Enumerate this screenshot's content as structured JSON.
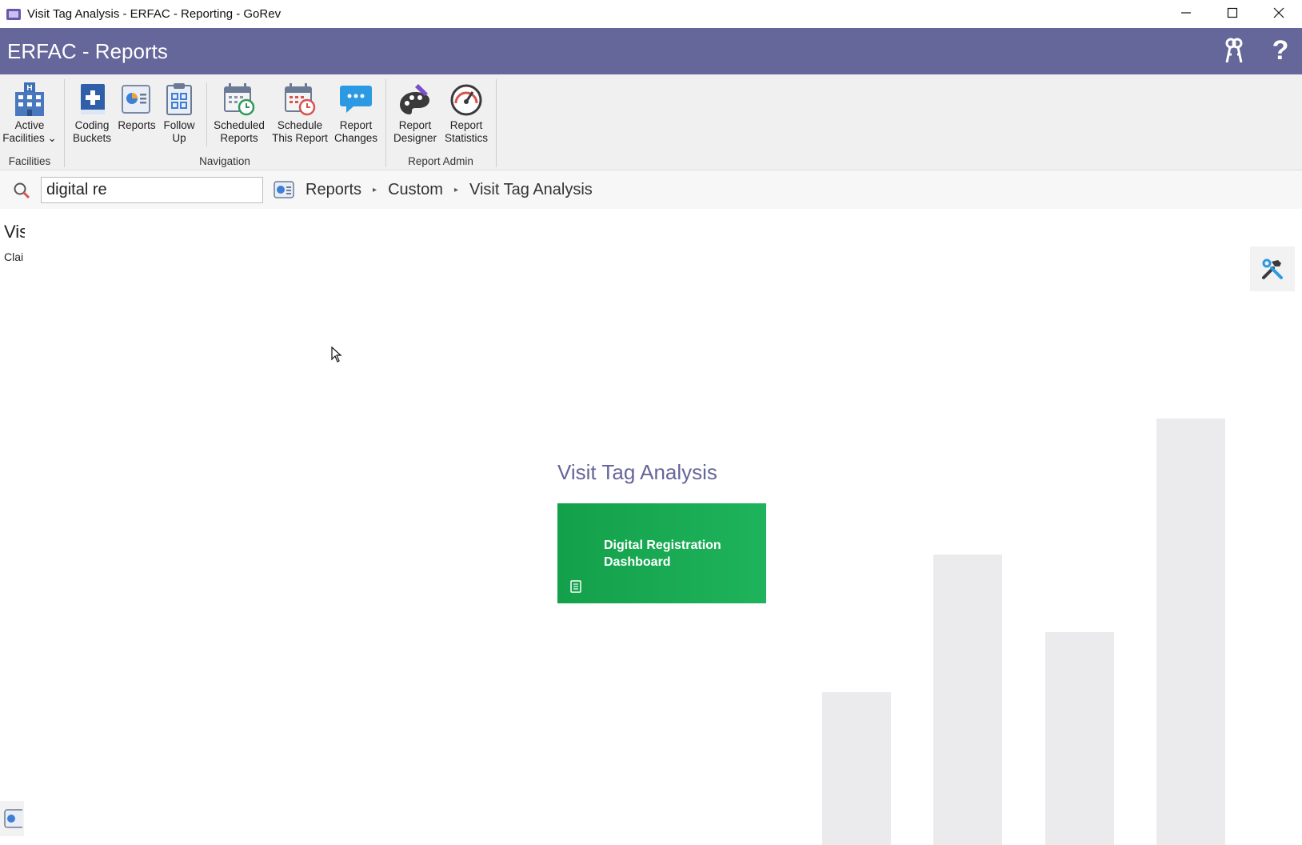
{
  "window": {
    "title": "Visit Tag Analysis - ERFAC - Reporting - GoRev",
    "controls": [
      "minimize-icon",
      "maximize-icon",
      "close-icon"
    ]
  },
  "header": {
    "title": "ERFAC - Reports",
    "icons": [
      "keys-icon",
      "help-icon"
    ],
    "help_glyph": "?"
  },
  "ribbon": {
    "groups": [
      {
        "label": "Facilities",
        "buttons": [
          {
            "label": "Active\nFacilities ⌄",
            "icon": "hospital-icon"
          }
        ]
      },
      {
        "label": "Navigation",
        "buttons": [
          {
            "label": "Coding\nBuckets",
            "icon": "coding-book-icon"
          },
          {
            "label": "Reports",
            "icon": "reports-icon"
          },
          {
            "label": "Follow\nUp",
            "icon": "clipboard-icon"
          },
          {
            "label": "Scheduled\nReports",
            "icon": "calendar-clock-icon"
          },
          {
            "label": "Schedule\nThis Report",
            "icon": "calendar-clock-red-icon"
          },
          {
            "label": "Report\nChanges",
            "icon": "chat-bubble-icon"
          }
        ]
      },
      {
        "label": "Report Admin",
        "buttons": [
          {
            "label": "Report\nDesigner",
            "icon": "palette-icon"
          },
          {
            "label": "Report\nStatistics",
            "icon": "gauge-icon"
          }
        ]
      }
    ]
  },
  "nav": {
    "search_value": "digital re",
    "breadcrumbs": [
      "Reports",
      "Custom",
      "Visit Tag Analysis"
    ]
  },
  "content": {
    "truncated_title": "Vis",
    "truncated_subtitle": "Clai",
    "section_title": "Visit Tag Analysis",
    "tile_label": "Digital Registration Dashboard",
    "colors": {
      "accent": "#656699",
      "tile": "#1aab55",
      "bars": "#ebebed"
    }
  }
}
